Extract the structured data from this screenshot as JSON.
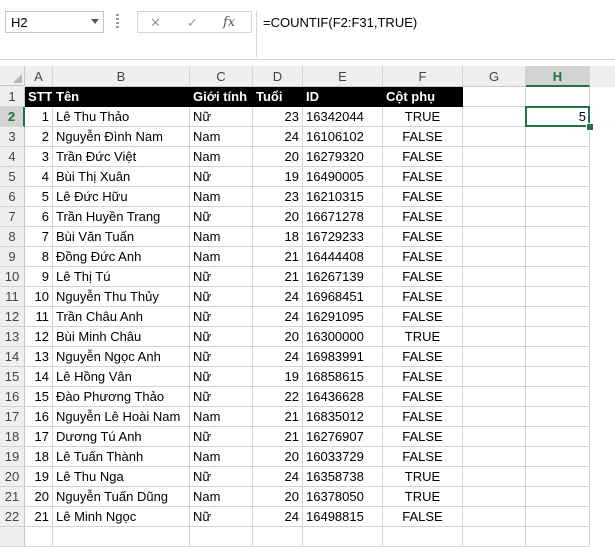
{
  "formula_bar": {
    "name_box": "H2",
    "cancel_icon": "✕",
    "enter_icon": "✓",
    "fx_label": "fx",
    "formula": "=COUNTIF(F2:F31,TRUE)"
  },
  "columns": [
    "A",
    "B",
    "C",
    "D",
    "E",
    "F",
    "G",
    "H"
  ],
  "selected_column": "H",
  "selected_row": "2",
  "headers": {
    "stt": "STT",
    "ten": "Tên",
    "gioi_tinh": "Giới tính",
    "tuoi": "Tuổi",
    "id": "ID",
    "cot_phu": "Cột phụ"
  },
  "h2_value": "5",
  "rows": [
    {
      "num": "2",
      "stt": "1",
      "ten": "Lê Thu Thảo",
      "gioi": "Nữ",
      "tuoi": "23",
      "id": "16342044",
      "phu": "TRUE"
    },
    {
      "num": "3",
      "stt": "2",
      "ten": "Nguyễn Đình Nam",
      "gioi": "Nam",
      "tuoi": "24",
      "id": "16106102",
      "phu": "FALSE"
    },
    {
      "num": "4",
      "stt": "3",
      "ten": "Trần Đức Việt",
      "gioi": "Nam",
      "tuoi": "20",
      "id": "16279320",
      "phu": "FALSE"
    },
    {
      "num": "5",
      "stt": "4",
      "ten": "Bùi Thị Xuân",
      "gioi": "Nữ",
      "tuoi": "19",
      "id": "16490005",
      "phu": "FALSE"
    },
    {
      "num": "6",
      "stt": "5",
      "ten": "Lê Đức Hữu",
      "gioi": "Nam",
      "tuoi": "23",
      "id": "16210315",
      "phu": "FALSE"
    },
    {
      "num": "7",
      "stt": "6",
      "ten": "Trần Huyền Trang",
      "gioi": "Nữ",
      "tuoi": "20",
      "id": "16671278",
      "phu": "FALSE"
    },
    {
      "num": "8",
      "stt": "7",
      "ten": "Bùi Văn Tuấn",
      "gioi": "Nam",
      "tuoi": "18",
      "id": "16729233",
      "phu": "FALSE"
    },
    {
      "num": "9",
      "stt": "8",
      "ten": "Đồng Đức Anh",
      "gioi": "Nam",
      "tuoi": "21",
      "id": "16444408",
      "phu": "FALSE"
    },
    {
      "num": "10",
      "stt": "9",
      "ten": "Lê Thị Tú",
      "gioi": "Nữ",
      "tuoi": "21",
      "id": "16267139",
      "phu": "FALSE"
    },
    {
      "num": "11",
      "stt": "10",
      "ten": "Nguyễn Thu Thủy",
      "gioi": "Nữ",
      "tuoi": "24",
      "id": "16968451",
      "phu": "FALSE"
    },
    {
      "num": "12",
      "stt": "11",
      "ten": "Trần Châu Anh",
      "gioi": "Nữ",
      "tuoi": "24",
      "id": "16291095",
      "phu": "FALSE"
    },
    {
      "num": "13",
      "stt": "12",
      "ten": "Bùi Minh Châu",
      "gioi": "Nữ",
      "tuoi": "20",
      "id": "16300000",
      "phu": "TRUE"
    },
    {
      "num": "14",
      "stt": "13",
      "ten": "Nguyễn Ngọc Anh",
      "gioi": "Nữ",
      "tuoi": "24",
      "id": "16983991",
      "phu": "FALSE"
    },
    {
      "num": "15",
      "stt": "14",
      "ten": "Lê Hồng Vân",
      "gioi": "Nữ",
      "tuoi": "19",
      "id": "16858615",
      "phu": "FALSE"
    },
    {
      "num": "16",
      "stt": "15",
      "ten": "Đào Phương Thảo",
      "gioi": "Nữ",
      "tuoi": "22",
      "id": "16436628",
      "phu": "FALSE"
    },
    {
      "num": "17",
      "stt": "16",
      "ten": "Nguyễn Lê Hoài Nam",
      "gioi": "Nam",
      "tuoi": "21",
      "id": "16835012",
      "phu": "FALSE"
    },
    {
      "num": "18",
      "stt": "17",
      "ten": "Dương Tú Anh",
      "gioi": "Nữ",
      "tuoi": "21",
      "id": "16276907",
      "phu": "FALSE"
    },
    {
      "num": "19",
      "stt": "18",
      "ten": "Lê Tuấn Thành",
      "gioi": "Nam",
      "tuoi": "20",
      "id": "16033729",
      "phu": "FALSE"
    },
    {
      "num": "20",
      "stt": "19",
      "ten": "Lê Thu Nga",
      "gioi": "Nữ",
      "tuoi": "24",
      "id": "16358738",
      "phu": "TRUE"
    },
    {
      "num": "21",
      "stt": "20",
      "ten": "Nguyễn Tuấn Dũng",
      "gioi": "Nam",
      "tuoi": "20",
      "id": "16378050",
      "phu": "TRUE"
    },
    {
      "num": "22",
      "stt": "21",
      "ten": "Lê Minh Ngọc",
      "gioi": "Nữ",
      "tuoi": "24",
      "id": "16498815",
      "phu": "FALSE"
    }
  ]
}
